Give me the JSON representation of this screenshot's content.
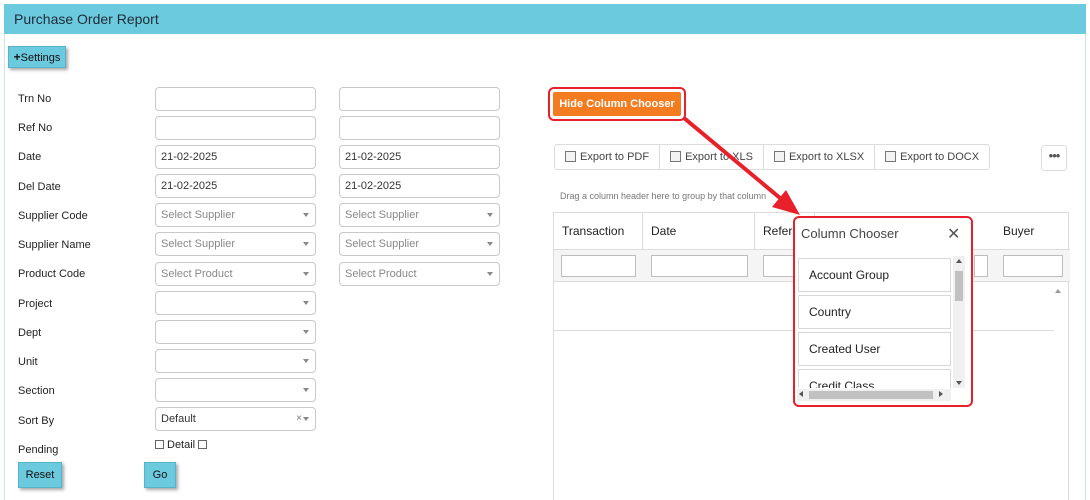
{
  "page": {
    "title": "Purchase Order Report"
  },
  "settings": {
    "icon": "plus-icon",
    "icon_glyph": "+",
    "label": "Settings"
  },
  "filters": {
    "trn_no": {
      "label": "Trn No",
      "from": "",
      "to": ""
    },
    "ref_no": {
      "label": "Ref No",
      "from": "",
      "to": ""
    },
    "date": {
      "label": "Date",
      "from": "21-02-2025",
      "to": "21-02-2025"
    },
    "del_date": {
      "label": "Del Date",
      "from": "21-02-2025",
      "to": "21-02-2025"
    },
    "supplier_code": {
      "label": "Supplier Code",
      "from": "Select Supplier",
      "to": "Select Supplier"
    },
    "supplier_name": {
      "label": "Supplier Name",
      "from": "Select Supplier",
      "to": "Select Supplier"
    },
    "product_code": {
      "label": "Product Code",
      "from": "Select Product",
      "to": "Select Product"
    },
    "project": {
      "label": "Project",
      "value": ""
    },
    "dept": {
      "label": "Dept",
      "value": ""
    },
    "unit": {
      "label": "Unit",
      "value": ""
    },
    "section": {
      "label": "Section",
      "value": ""
    },
    "sort_by": {
      "label": "Sort By",
      "value": "Default",
      "clear": "×"
    },
    "pending": {
      "label": "Pending",
      "detail_label": "Detail"
    }
  },
  "actions": {
    "reset": "Reset",
    "go": "Go"
  },
  "grid_panel": {
    "hide_chooser": "Hide Column Chooser",
    "toolbar": [
      {
        "label": "Export to PDF",
        "icon": "pdf-export-icon"
      },
      {
        "label": "Export to XLS",
        "icon": "xls-export-icon"
      },
      {
        "label": "Export to XLSX",
        "icon": "xlsx-export-icon"
      },
      {
        "label": "Export to DOCX",
        "icon": "docx-export-icon"
      }
    ],
    "more": "•••",
    "group_hint": "Drag a column header here to group by that column",
    "columns": [
      "Transaction",
      "Date",
      "Refer",
      "Buyer"
    ]
  },
  "column_chooser": {
    "title": "Column Chooser",
    "close": "✕",
    "items": [
      "Account Group",
      "Country",
      "Created User",
      "Credit Class"
    ]
  },
  "colors": {
    "header_bar": "#6ccadf",
    "orange_button": "#f47c20",
    "highlight": "#e8202a"
  }
}
